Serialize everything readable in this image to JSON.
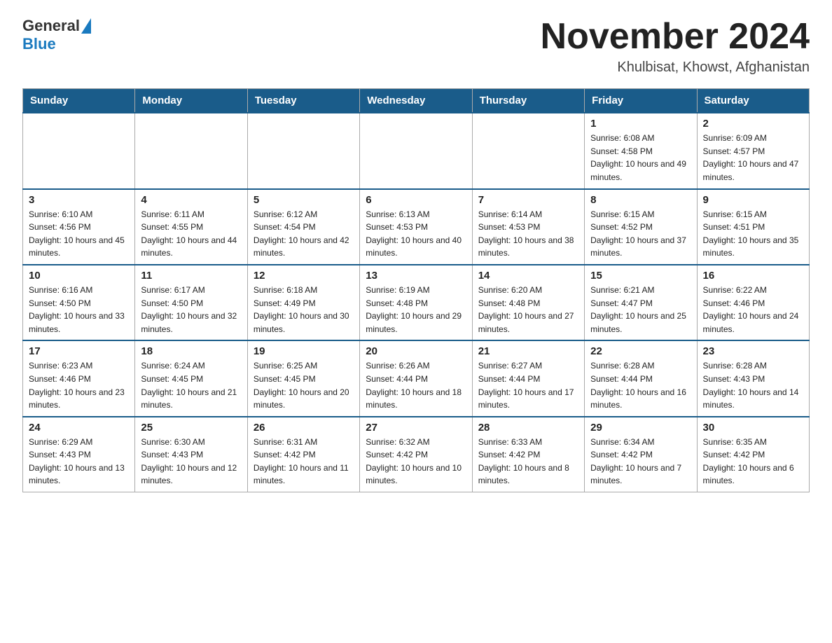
{
  "header": {
    "logo_general": "General",
    "logo_blue": "Blue",
    "month_title": "November 2024",
    "location": "Khulbisat, Khowst, Afghanistan"
  },
  "days_of_week": [
    "Sunday",
    "Monday",
    "Tuesday",
    "Wednesday",
    "Thursday",
    "Friday",
    "Saturday"
  ],
  "weeks": [
    [
      {
        "day": "",
        "info": ""
      },
      {
        "day": "",
        "info": ""
      },
      {
        "day": "",
        "info": ""
      },
      {
        "day": "",
        "info": ""
      },
      {
        "day": "",
        "info": ""
      },
      {
        "day": "1",
        "info": "Sunrise: 6:08 AM\nSunset: 4:58 PM\nDaylight: 10 hours and 49 minutes."
      },
      {
        "day": "2",
        "info": "Sunrise: 6:09 AM\nSunset: 4:57 PM\nDaylight: 10 hours and 47 minutes."
      }
    ],
    [
      {
        "day": "3",
        "info": "Sunrise: 6:10 AM\nSunset: 4:56 PM\nDaylight: 10 hours and 45 minutes."
      },
      {
        "day": "4",
        "info": "Sunrise: 6:11 AM\nSunset: 4:55 PM\nDaylight: 10 hours and 44 minutes."
      },
      {
        "day": "5",
        "info": "Sunrise: 6:12 AM\nSunset: 4:54 PM\nDaylight: 10 hours and 42 minutes."
      },
      {
        "day": "6",
        "info": "Sunrise: 6:13 AM\nSunset: 4:53 PM\nDaylight: 10 hours and 40 minutes."
      },
      {
        "day": "7",
        "info": "Sunrise: 6:14 AM\nSunset: 4:53 PM\nDaylight: 10 hours and 38 minutes."
      },
      {
        "day": "8",
        "info": "Sunrise: 6:15 AM\nSunset: 4:52 PM\nDaylight: 10 hours and 37 minutes."
      },
      {
        "day": "9",
        "info": "Sunrise: 6:15 AM\nSunset: 4:51 PM\nDaylight: 10 hours and 35 minutes."
      }
    ],
    [
      {
        "day": "10",
        "info": "Sunrise: 6:16 AM\nSunset: 4:50 PM\nDaylight: 10 hours and 33 minutes."
      },
      {
        "day": "11",
        "info": "Sunrise: 6:17 AM\nSunset: 4:50 PM\nDaylight: 10 hours and 32 minutes."
      },
      {
        "day": "12",
        "info": "Sunrise: 6:18 AM\nSunset: 4:49 PM\nDaylight: 10 hours and 30 minutes."
      },
      {
        "day": "13",
        "info": "Sunrise: 6:19 AM\nSunset: 4:48 PM\nDaylight: 10 hours and 29 minutes."
      },
      {
        "day": "14",
        "info": "Sunrise: 6:20 AM\nSunset: 4:48 PM\nDaylight: 10 hours and 27 minutes."
      },
      {
        "day": "15",
        "info": "Sunrise: 6:21 AM\nSunset: 4:47 PM\nDaylight: 10 hours and 25 minutes."
      },
      {
        "day": "16",
        "info": "Sunrise: 6:22 AM\nSunset: 4:46 PM\nDaylight: 10 hours and 24 minutes."
      }
    ],
    [
      {
        "day": "17",
        "info": "Sunrise: 6:23 AM\nSunset: 4:46 PM\nDaylight: 10 hours and 23 minutes."
      },
      {
        "day": "18",
        "info": "Sunrise: 6:24 AM\nSunset: 4:45 PM\nDaylight: 10 hours and 21 minutes."
      },
      {
        "day": "19",
        "info": "Sunrise: 6:25 AM\nSunset: 4:45 PM\nDaylight: 10 hours and 20 minutes."
      },
      {
        "day": "20",
        "info": "Sunrise: 6:26 AM\nSunset: 4:44 PM\nDaylight: 10 hours and 18 minutes."
      },
      {
        "day": "21",
        "info": "Sunrise: 6:27 AM\nSunset: 4:44 PM\nDaylight: 10 hours and 17 minutes."
      },
      {
        "day": "22",
        "info": "Sunrise: 6:28 AM\nSunset: 4:44 PM\nDaylight: 10 hours and 16 minutes."
      },
      {
        "day": "23",
        "info": "Sunrise: 6:28 AM\nSunset: 4:43 PM\nDaylight: 10 hours and 14 minutes."
      }
    ],
    [
      {
        "day": "24",
        "info": "Sunrise: 6:29 AM\nSunset: 4:43 PM\nDaylight: 10 hours and 13 minutes."
      },
      {
        "day": "25",
        "info": "Sunrise: 6:30 AM\nSunset: 4:43 PM\nDaylight: 10 hours and 12 minutes."
      },
      {
        "day": "26",
        "info": "Sunrise: 6:31 AM\nSunset: 4:42 PM\nDaylight: 10 hours and 11 minutes."
      },
      {
        "day": "27",
        "info": "Sunrise: 6:32 AM\nSunset: 4:42 PM\nDaylight: 10 hours and 10 minutes."
      },
      {
        "day": "28",
        "info": "Sunrise: 6:33 AM\nSunset: 4:42 PM\nDaylight: 10 hours and 8 minutes."
      },
      {
        "day": "29",
        "info": "Sunrise: 6:34 AM\nSunset: 4:42 PM\nDaylight: 10 hours and 7 minutes."
      },
      {
        "day": "30",
        "info": "Sunrise: 6:35 AM\nSunset: 4:42 PM\nDaylight: 10 hours and 6 minutes."
      }
    ]
  ]
}
